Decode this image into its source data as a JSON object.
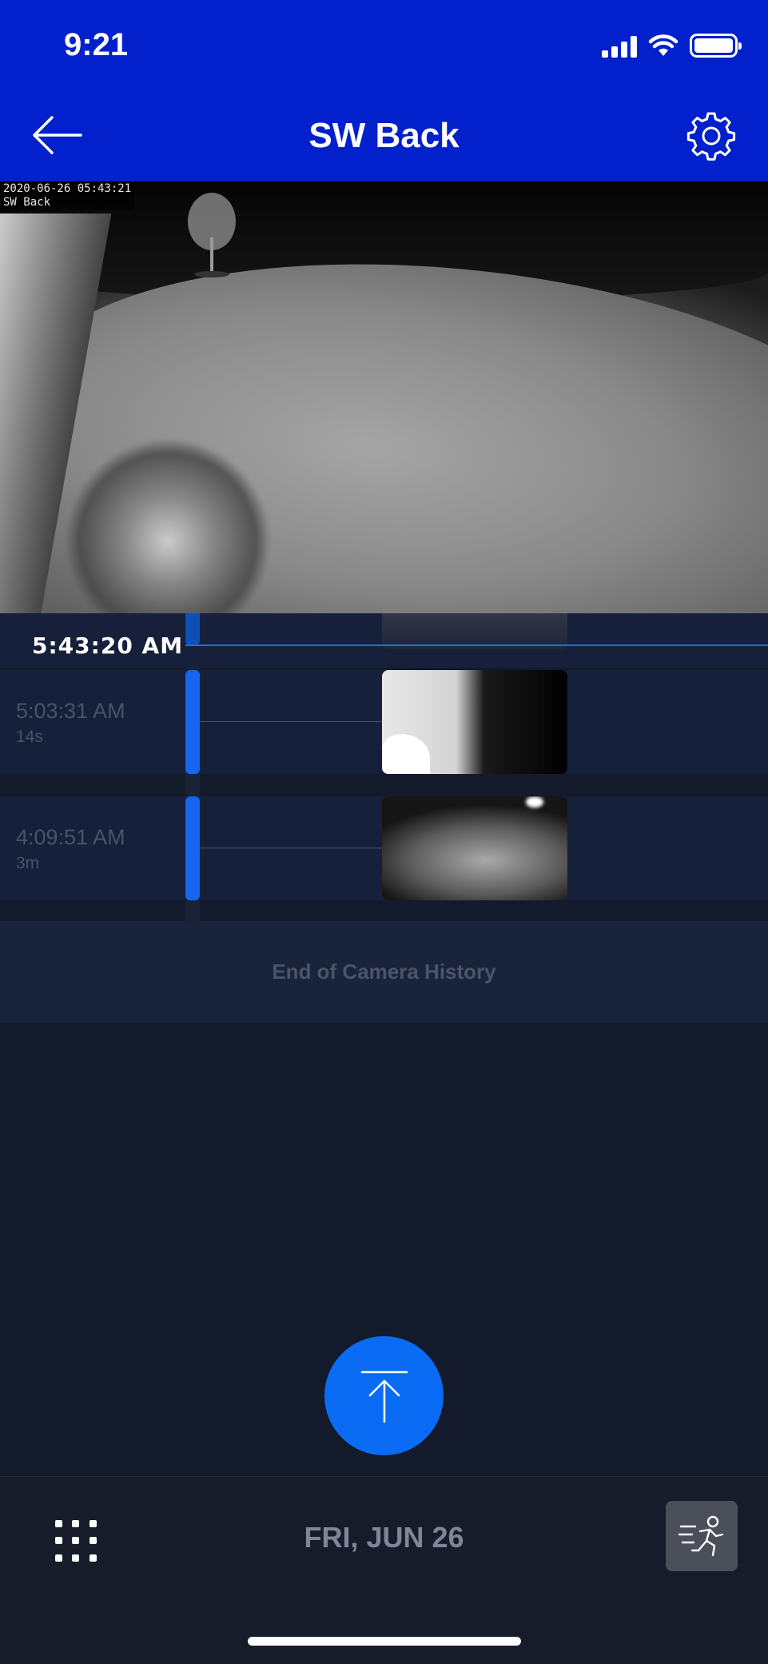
{
  "status_bar": {
    "time": "9:21"
  },
  "nav": {
    "title": "SW Back",
    "back_icon": "arrow-left-icon",
    "settings_icon": "gear-icon"
  },
  "camera": {
    "overlay_timestamp": "2020-06-26 05:43:21",
    "overlay_name": "SW Back"
  },
  "timeline": {
    "current_time": "5:43:20 AM",
    "events": [
      {
        "time": "5:03:31 AM",
        "duration": "14s"
      },
      {
        "time": "4:09:51 AM",
        "duration": "3m"
      }
    ],
    "end_label": "End of Camera History"
  },
  "bottom_bar": {
    "date": "FRI, JUN 26"
  },
  "colors": {
    "accent": "#0221cc",
    "button_blue": "#0a6cf5",
    "event_bar": "#1566f0",
    "background": "#121a2b"
  }
}
